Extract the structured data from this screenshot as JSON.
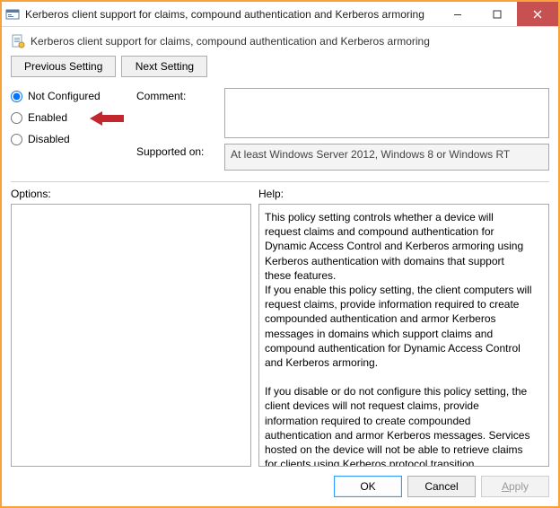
{
  "titlebar": {
    "title": "Kerberos client support for claims, compound authentication and Kerberos armoring"
  },
  "subtitle": "Kerberos client support for claims, compound authentication and Kerberos armoring",
  "nav": {
    "previous": "Previous Setting",
    "next": "Next Setting"
  },
  "state": {
    "not_configured": "Not Configured",
    "enabled": "Enabled",
    "disabled": "Disabled",
    "selected": "not_configured"
  },
  "annotations": {
    "arrow_color": "#c1272d"
  },
  "labels": {
    "comment": "Comment:",
    "supported_on": "Supported on:",
    "options": "Options:",
    "help": "Help:"
  },
  "comment_value": "",
  "supported_on_value": "At least Windows Server 2012, Windows 8 or Windows RT",
  "options_value": "",
  "help_text": "This policy setting controls whether a device will request claims and compound authentication for Dynamic Access Control and Kerberos armoring using Kerberos authentication with domains that support these features.\nIf you enable this policy setting, the client computers will request claims, provide information required to create compounded authentication and armor Kerberos messages in domains which support claims and compound authentication for Dynamic Access Control and Kerberos armoring.\n\nIf you disable or do not configure this policy setting, the client devices will not request claims, provide information required to create compounded authentication and armor Kerberos messages. Services hosted on the device will not be able to retrieve claims for clients using Kerberos protocol transition.",
  "footer": {
    "ok": "OK",
    "cancel": "Cancel",
    "apply": "Apply"
  }
}
